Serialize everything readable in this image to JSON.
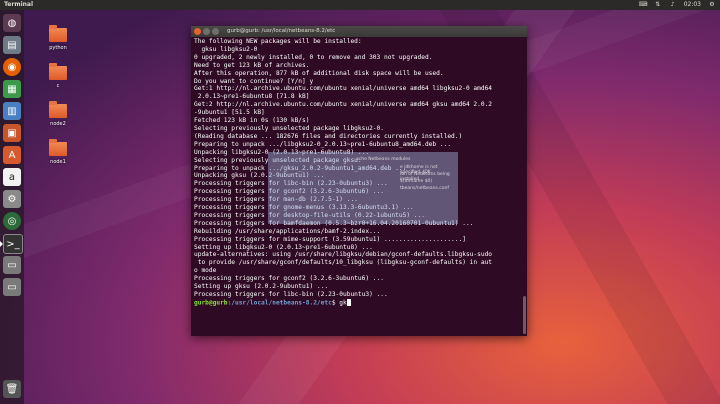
{
  "top_panel": {
    "title": "Terminal",
    "clock": "02:03"
  },
  "desktop_icons": [
    {
      "label": "python"
    },
    {
      "label": "c"
    },
    {
      "label": "node2"
    },
    {
      "label": "node1"
    }
  ],
  "terminal": {
    "title": "gurb@gurb: /usr/local/netbeans-8.2/etc",
    "lines": [
      "The following NEW packages will be installed:",
      "  gksu libgksu2-0",
      "0 upgraded, 2 newly installed, 0 to remove and 303 not upgraded.",
      "Need to get 123 kB of archives.",
      "After this operation, 877 kB of additional disk space will be used.",
      "Do you want to continue? [Y/n] y",
      "Get:1 http://nl.archive.ubuntu.com/ubuntu xenial/universe amd64 libgksu2-0 amd64",
      " 2.0.13~pre1-6ubuntu8 [71.8 kB]",
      "Get:2 http://nl.archive.ubuntu.com/ubuntu xenial/universe amd64 gksu amd64 2.0.2",
      "-9ubuntu1 [51.5 kB]",
      "Fetched 123 kB in 0s (130 kB/s)",
      "Selecting previously unselected package libgksu2-0.",
      "(Reading database ... 182676 files and directories currently installed.)",
      "Preparing to unpack .../libgksu2-0_2.0.13~pre1-6ubuntu8_amd64.deb ...",
      "Unpacking libgksu2-0 (2.0.13~pre1-6ubuntu8) ...",
      "Selecting previously unselected package gksu.",
      "Preparing to unpack .../gksu_2.0.2-9ubuntu1_amd64.deb ...",
      "Unpacking gksu (2.0.2-9ubuntu1) ...",
      "Processing triggers for libc-bin (2.23-0ubuntu3) ...",
      "Processing triggers for gconf2 (3.2.6-3ubuntu6) ...",
      "Processing triggers for man-db (2.7.5-1) ...",
      "Processing triggers for gnome-menus (3.13.3-6ubuntu3.1) ...",
      "Processing triggers for desktop-file-utils (0.22-1ubuntu5) ...",
      "Processing triggers for bamfdaemon (0.5.3~bzr0+16.04.20160701-0ubuntu1) ...",
      "Rebuilding /usr/share/applications/bamf-2.index...",
      "Processing triggers for mime-support (3.59ubuntu1) .....................]",
      "Setting up libgksu2-0 (2.0.13~pre1-6ubuntu8) ...",
      "update-alternatives: using /usr/share/libgksu/debian/gconf-defaults.libgksu-sudo",
      " to provide /usr/share/gconf/defaults/10_libgksu (libgksu-gconf-defaults) in aut",
      "o mode",
      "Processing triggers for gconf2 (3.2.6-3ubuntu6) ...",
      "Setting up gksu (2.0.2-9ubuntu1) ...",
      "Processing triggers for libc-bin (2.23-0ubuntu3) ..."
    ],
    "prompt_user": "gurb@gurb",
    "prompt_path": ":/usr/local/netbeans-8.2/etc",
    "prompt_symbol": "$ ",
    "command": "gk"
  },
  "ghost_window": {
    "lines": [
      "ache Netbeans modules",
      "e jdkhome is not specified, JDK",
      "ion of NetBeans being installed",
      "$(dirname $0)",
      "tbeans/netbeans.conf"
    ]
  }
}
